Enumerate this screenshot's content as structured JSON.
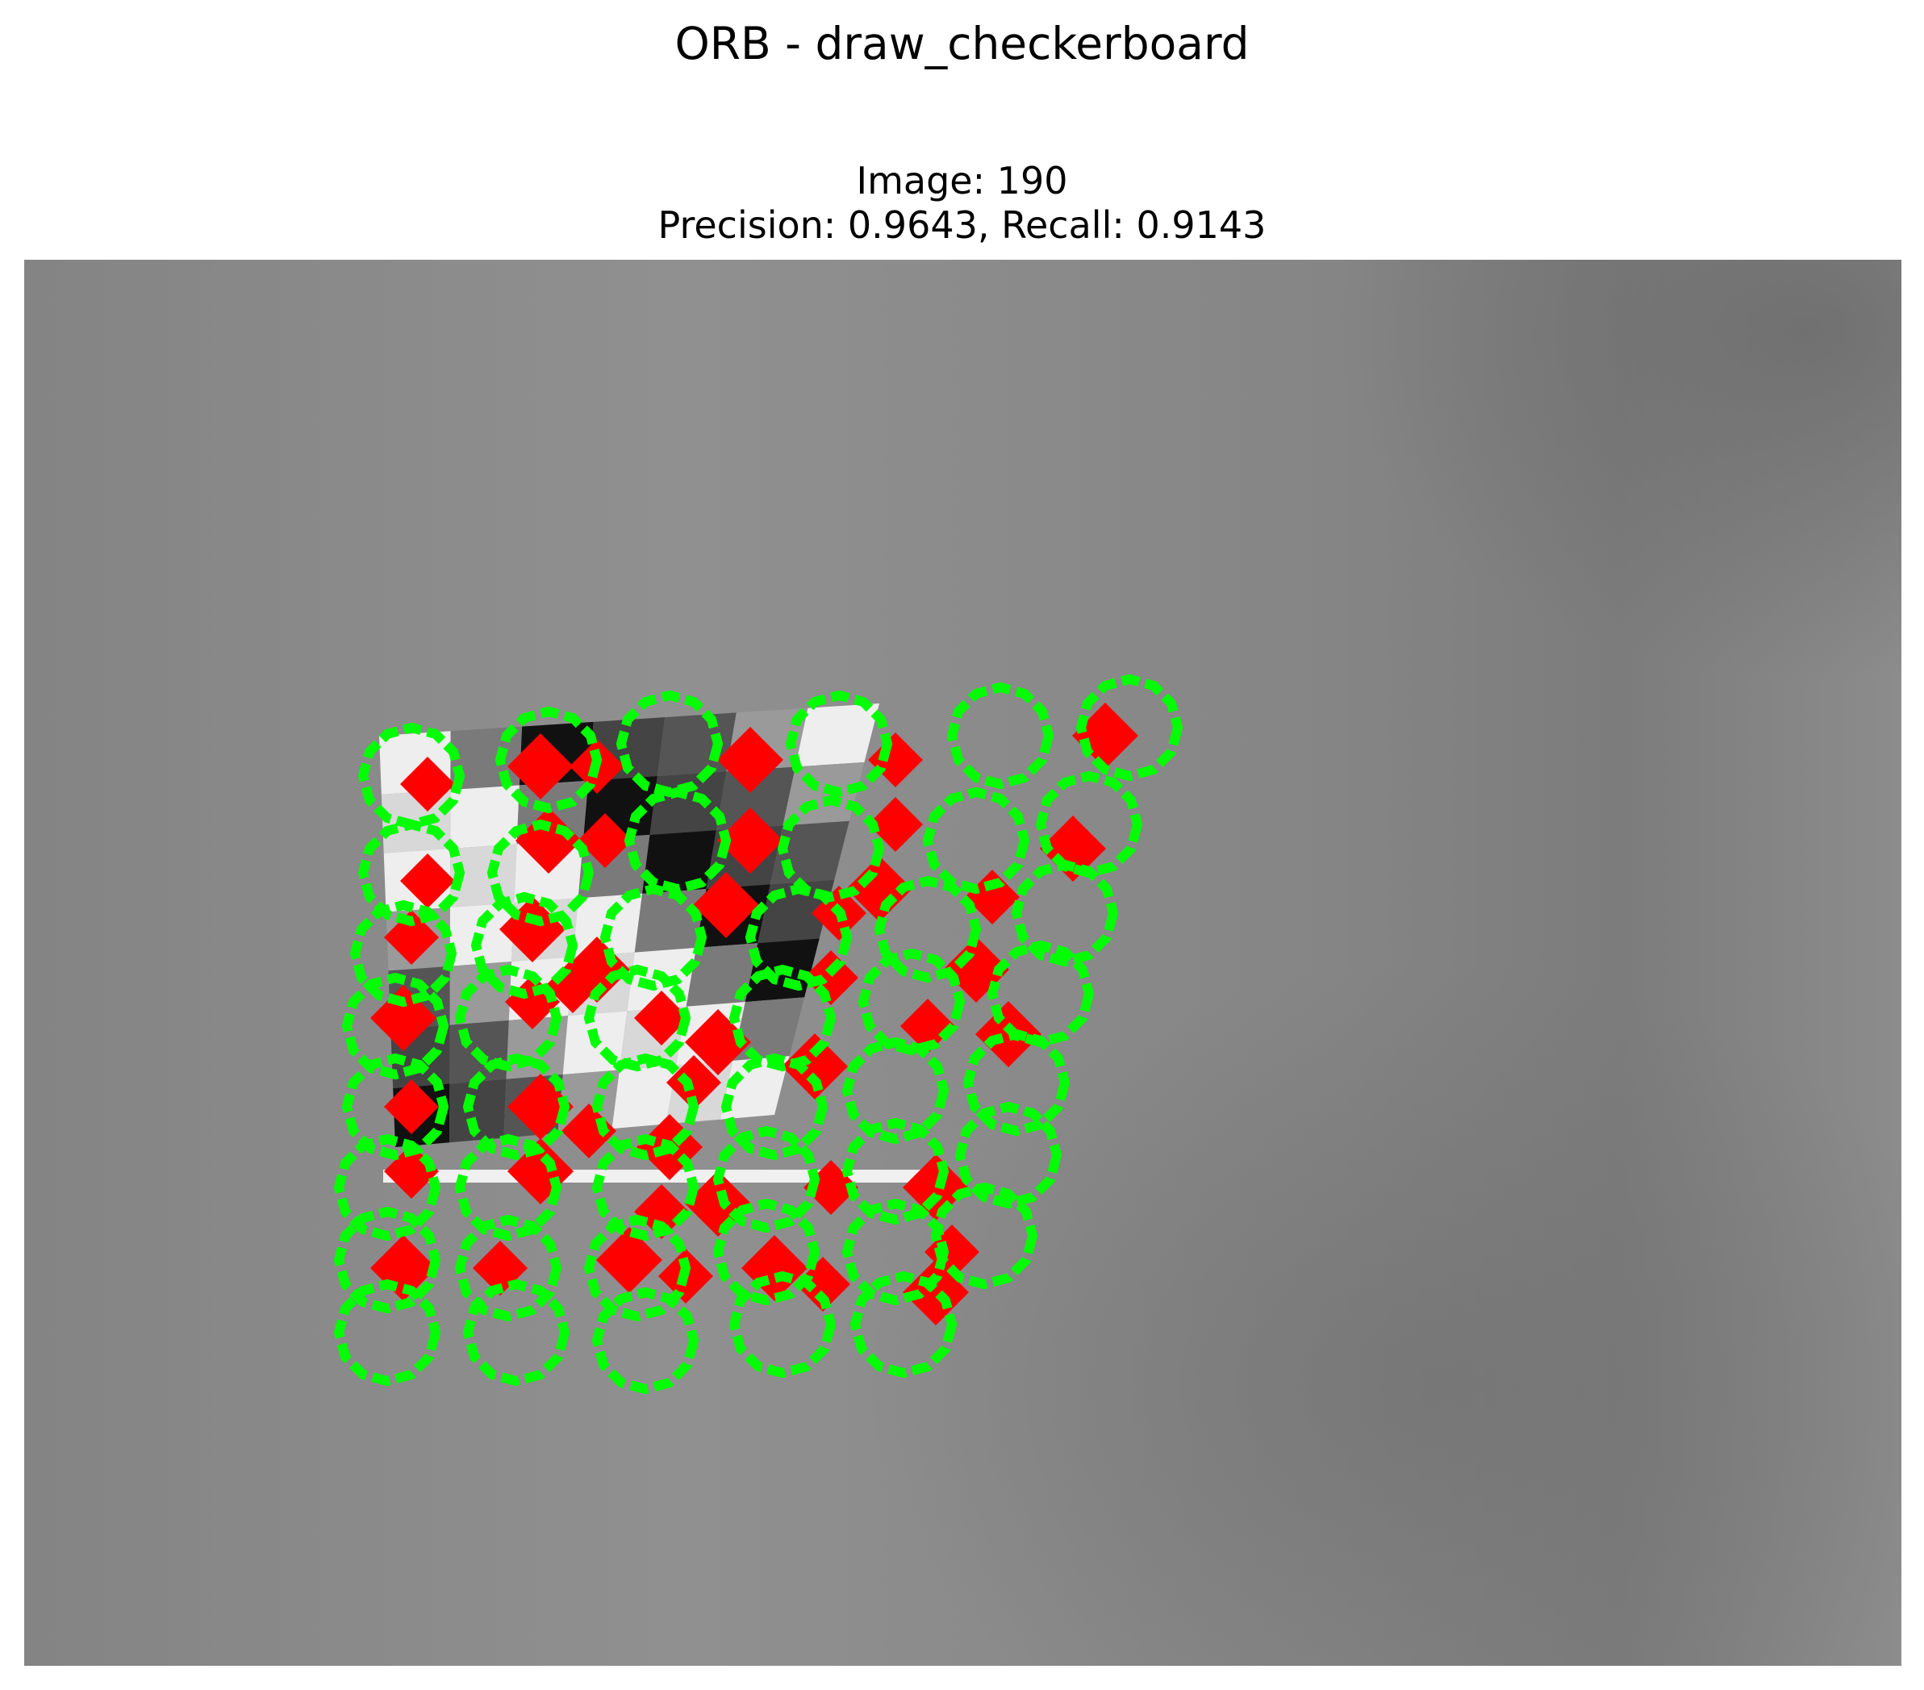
{
  "figure": {
    "suptitle": "ORB - draw_checkerboard",
    "image_label": "Image: 190",
    "metrics_label": "Precision: 0.9643, Recall: 0.9143"
  },
  "image": {
    "description_colors": {
      "background_gray": "#8a8a8a",
      "detected_keypoint_marker": "#00ff00",
      "ground_truth_marker": "#ff0000",
      "dark_square": "#111111",
      "light_square": "#eeeeee"
    },
    "icons": {
      "green_markers": "circle-outline",
      "red_markers": "filled-diamond-blob"
    }
  }
}
